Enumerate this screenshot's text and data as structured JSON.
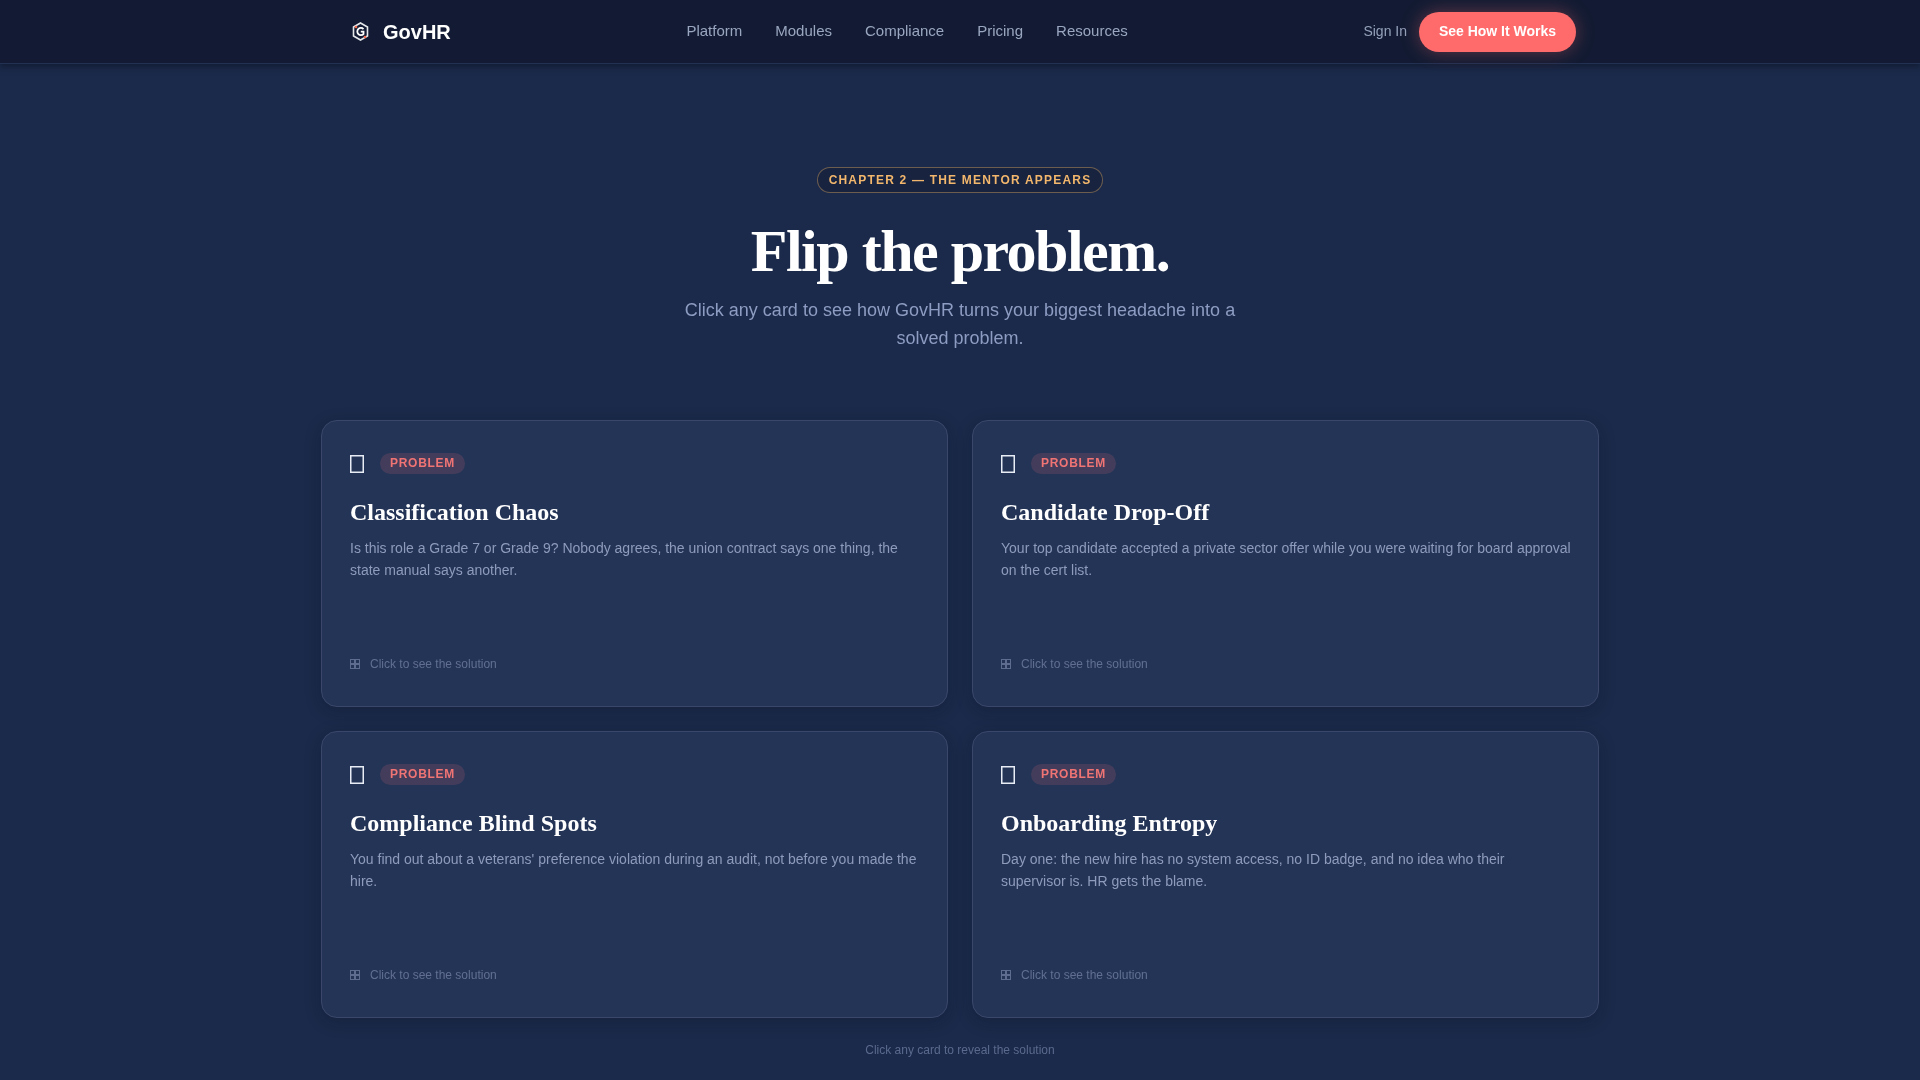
{
  "nav": {
    "brand": "GovHR",
    "links": [
      {
        "label": "Platform"
      },
      {
        "label": "Modules"
      },
      {
        "label": "Compliance"
      },
      {
        "label": "Pricing"
      },
      {
        "label": "Resources"
      }
    ],
    "sign_in": "Sign In",
    "cta": "See How It Works"
  },
  "hero": {
    "eyebrow": "CHAPTER 2 — THE MENTOR APPEARS",
    "title": "Flip the problem.",
    "subtitle": "Click any card to see how GovHR turns your biggest headache into a solved problem."
  },
  "cards": [
    {
      "tag": "PROBLEM",
      "title": "Classification Chaos",
      "body": "Is this role a Grade 7 or Grade 9? Nobody agrees, the union contract says one thing, the state manual says another.",
      "hint": "Click to see the solution"
    },
    {
      "tag": "PROBLEM",
      "title": "Candidate Drop-Off",
      "body": "Your top candidate accepted a private sector offer while you were waiting for board approval on the cert list.",
      "hint": "Click to see the solution"
    },
    {
      "tag": "PROBLEM",
      "title": "Compliance Blind Spots",
      "body": "You find out about a veterans' preference violation during an audit, not before you made the hire.",
      "hint": "Click to see the solution"
    },
    {
      "tag": "PROBLEM",
      "title": "Onboarding Entropy",
      "body": "Day one: the new hire has no system access, no ID badge, and no idea who their supervisor is. HR gets the blame.",
      "hint": "Click to see the solution"
    }
  ],
  "footer_hint": "Click any card to reveal the solution"
}
